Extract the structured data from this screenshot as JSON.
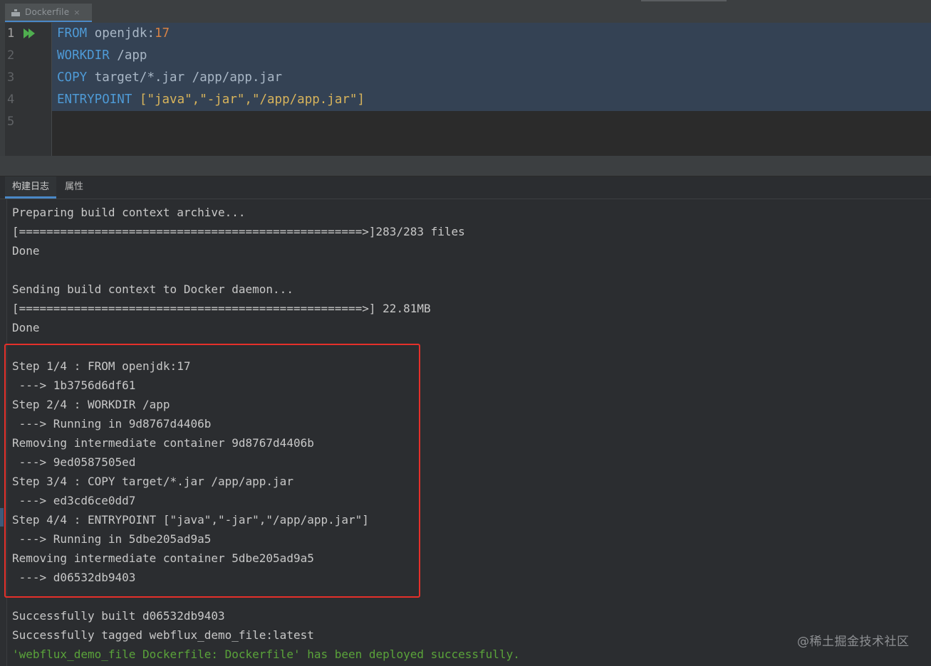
{
  "editor": {
    "tab": {
      "filename": "Dockerfile",
      "close_glyph": "×"
    },
    "icons": {
      "file_tab": "docker-icon",
      "gutter_run": "run-icon"
    },
    "line_numbers": [
      "1",
      "2",
      "3",
      "4",
      "5"
    ],
    "lines": [
      {
        "kw": "FROM",
        "rest": " openjdk:",
        "num": "17"
      },
      {
        "kw": "WORKDIR",
        "rest": " /app"
      },
      {
        "kw": "COPY",
        "rest": " target/*.jar /app/app.jar"
      },
      {
        "kw": "ENTRYPOINT",
        "rest": " ",
        "str": "[\"java\",\"-jar\",\"/app/app.jar\"]"
      }
    ]
  },
  "tool_window": {
    "tabs": [
      {
        "label": "构建日志",
        "active": true
      },
      {
        "label": "属性",
        "active": false
      }
    ]
  },
  "console": {
    "lines": [
      "Preparing build context archive...",
      "[==================================================>]283/283 files",
      "Done",
      "",
      "Sending build context to Docker daemon...",
      "[==================================================>] 22.81MB",
      "Done",
      "",
      "Step 1/4 : FROM openjdk:17",
      " ---> 1b3756d6df61",
      "Step 2/4 : WORKDIR /app",
      " ---> Running in 9d8767d4406b",
      "Removing intermediate container 9d8767d4406b",
      " ---> 9ed0587505ed",
      "Step 3/4 : COPY target/*.jar /app/app.jar",
      " ---> ed3cd6ce0dd7",
      "Step 4/4 : ENTRYPOINT [\"java\",\"-jar\",\"/app/app.jar\"]",
      " ---> Running in 5dbe205ad9a5",
      "Removing intermediate container 5dbe205ad9a5",
      " ---> d06532db9403",
      "",
      "Successfully built d06532db9403",
      "Successfully tagged webflux_demo_file:latest"
    ],
    "success_message": "'webflux_demo_file Dockerfile: Dockerfile' has been deployed successfully.",
    "highlight_color": "#e5302a"
  },
  "watermark": "@稀土掘金技术社区"
}
